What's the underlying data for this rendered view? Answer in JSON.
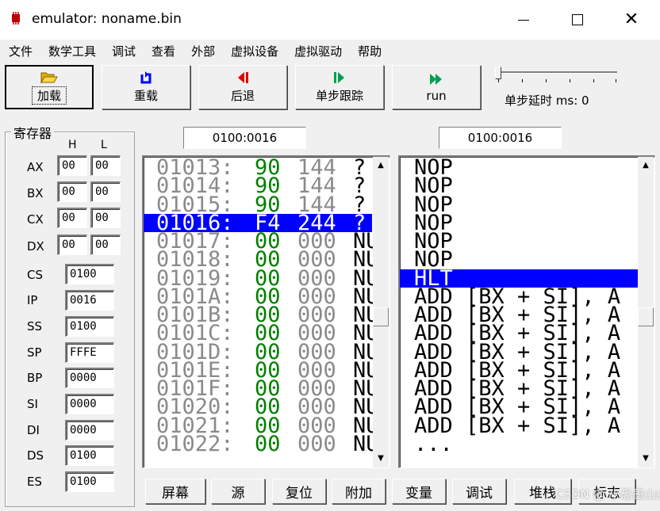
{
  "window": {
    "title": "emulator: noname.bin",
    "icon": "chip-icon",
    "controls": [
      "minimize-icon",
      "maximize-icon",
      "close-icon"
    ]
  },
  "menu": [
    "文件",
    "数学工具",
    "调试",
    "查看",
    "外部",
    "虚拟设备",
    "虚拟驱动",
    "帮助"
  ],
  "toolbar": {
    "buttons": [
      {
        "label": "加载",
        "icon": "folder-open-icon",
        "color": "#c8a000"
      },
      {
        "label": "重载",
        "icon": "reload-icon",
        "color": "#0000ff"
      },
      {
        "label": "后退",
        "icon": "step-back-icon",
        "color": "#e00000"
      },
      {
        "label": "单步跟踪",
        "icon": "step-forward-icon",
        "color": "#00a050"
      },
      {
        "label": "run",
        "icon": "run-icon",
        "color": "#00a050"
      }
    ],
    "step_delay_label": "单步延时 ms: 0"
  },
  "registers": {
    "title": "寄存器",
    "col_h": "H",
    "col_l": "L",
    "split": [
      {
        "name": "AX",
        "h": "00",
        "l": "00"
      },
      {
        "name": "BX",
        "h": "00",
        "l": "00"
      },
      {
        "name": "CX",
        "h": "00",
        "l": "00"
      },
      {
        "name": "DX",
        "h": "00",
        "l": "00"
      }
    ],
    "full": [
      {
        "name": "CS",
        "value": "0100"
      },
      {
        "name": "IP",
        "value": "0016"
      },
      {
        "name": "SS",
        "value": "0100"
      },
      {
        "name": "SP",
        "value": "FFFE"
      },
      {
        "name": "BP",
        "value": "0000"
      },
      {
        "name": "SI",
        "value": "0000"
      },
      {
        "name": "DI",
        "value": "0000"
      },
      {
        "name": "DS",
        "value": "0100"
      },
      {
        "name": "ES",
        "value": "0100"
      }
    ]
  },
  "memory": {
    "address": "0100:0016",
    "rows": [
      {
        "addr": "01013:",
        "hex": "90",
        "dec": "144",
        "chr": "?"
      },
      {
        "addr": "01014:",
        "hex": "90",
        "dec": "144",
        "chr": "?"
      },
      {
        "addr": "01015:",
        "hex": "90",
        "dec": "144",
        "chr": "?"
      },
      {
        "addr": "01016:",
        "hex": "F4",
        "dec": "244",
        "chr": "?",
        "selected": true
      },
      {
        "addr": "01017:",
        "hex": "00",
        "dec": "000",
        "chr": "NU"
      },
      {
        "addr": "01018:",
        "hex": "00",
        "dec": "000",
        "chr": "NU"
      },
      {
        "addr": "01019:",
        "hex": "00",
        "dec": "000",
        "chr": "NU"
      },
      {
        "addr": "0101A:",
        "hex": "00",
        "dec": "000",
        "chr": "NU"
      },
      {
        "addr": "0101B:",
        "hex": "00",
        "dec": "000",
        "chr": "NU"
      },
      {
        "addr": "0101C:",
        "hex": "00",
        "dec": "000",
        "chr": "NU"
      },
      {
        "addr": "0101D:",
        "hex": "00",
        "dec": "000",
        "chr": "NU"
      },
      {
        "addr": "0101E:",
        "hex": "00",
        "dec": "000",
        "chr": "NU"
      },
      {
        "addr": "0101F:",
        "hex": "00",
        "dec": "000",
        "chr": "NU"
      },
      {
        "addr": "01020:",
        "hex": "00",
        "dec": "000",
        "chr": "NU"
      },
      {
        "addr": "01021:",
        "hex": "00",
        "dec": "000",
        "chr": "NU"
      },
      {
        "addr": "01022:",
        "hex": "00",
        "dec": "000",
        "chr": "NU"
      }
    ]
  },
  "disassembly": {
    "address": "0100:0016",
    "rows": [
      {
        "text": "NOP"
      },
      {
        "text": "NOP"
      },
      {
        "text": "NOP"
      },
      {
        "text": "NOP"
      },
      {
        "text": "NOP"
      },
      {
        "text": "NOP"
      },
      {
        "text": "HLT",
        "selected": true
      },
      {
        "text": "ADD [BX + SI], A"
      },
      {
        "text": "ADD [BX + SI], A"
      },
      {
        "text": "ADD [BX + SI], A"
      },
      {
        "text": "ADD [BX + SI], A"
      },
      {
        "text": "ADD [BX + SI], A"
      },
      {
        "text": "ADD [BX + SI], A"
      },
      {
        "text": "ADD [BX + SI], A"
      },
      {
        "text": "ADD [BX + SI], A"
      },
      {
        "text": "..."
      }
    ]
  },
  "bottom_buttons": [
    "屏幕",
    "源",
    "复位",
    "附加",
    "变量",
    "调试",
    "堆栈",
    "标志"
  ],
  "watermark": "CSDN @ 小恐墨山山"
}
